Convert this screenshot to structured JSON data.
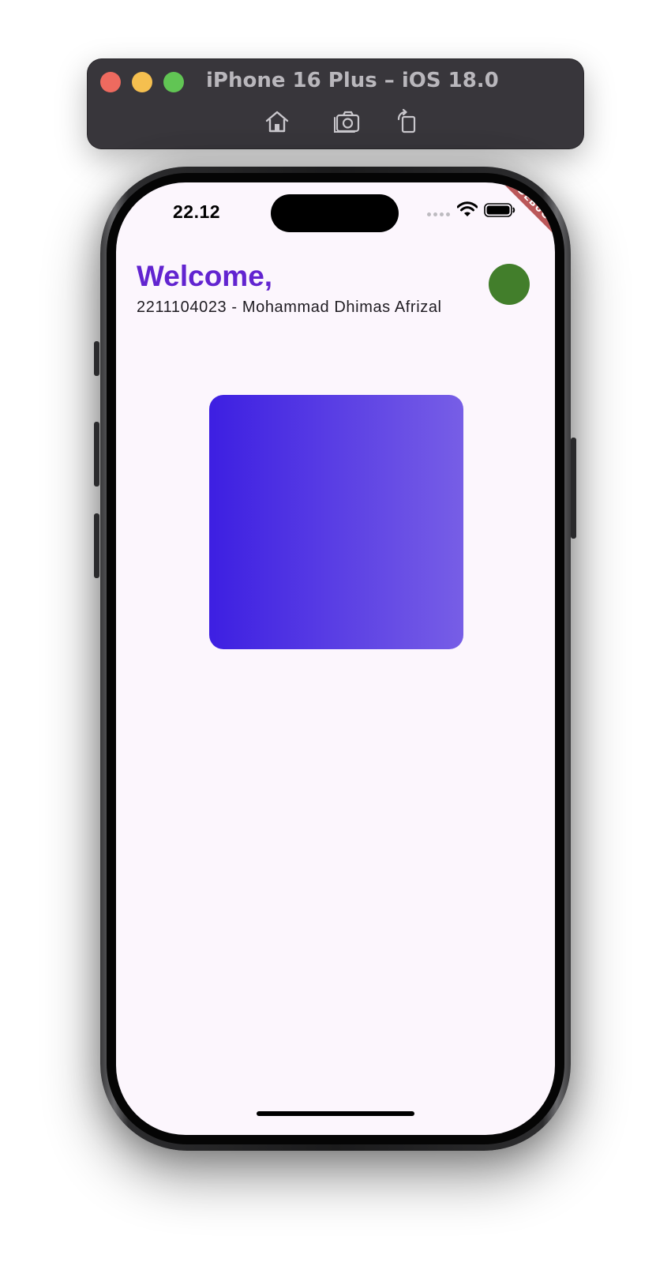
{
  "simulator": {
    "title": "iPhone 16 Plus – iOS 18.0",
    "toolbar": {
      "home_icon": "house-icon",
      "screenshot_icon": "camera-icon",
      "rotate_icon": "rotate-icon"
    },
    "traffic_lights": {
      "close_color": "#ee6a5f",
      "minimize_color": "#f5bf4f",
      "maximize_color": "#61c554"
    }
  },
  "status_bar": {
    "time": "22.12",
    "wifi_icon": "wifi-icon",
    "battery_icon": "battery-icon"
  },
  "debug_banner": {
    "label": "DEBUG"
  },
  "app": {
    "welcome": "Welcome,",
    "subtitle": "2211104023 - Mohammad Dhimas Afrizal",
    "accent_color": "#6224d0",
    "avatar_color": "#427e2b",
    "background_color": "#fcf6fd",
    "gradient": {
      "start_color": "#3d1fe2",
      "end_color": "#775ee6"
    }
  }
}
